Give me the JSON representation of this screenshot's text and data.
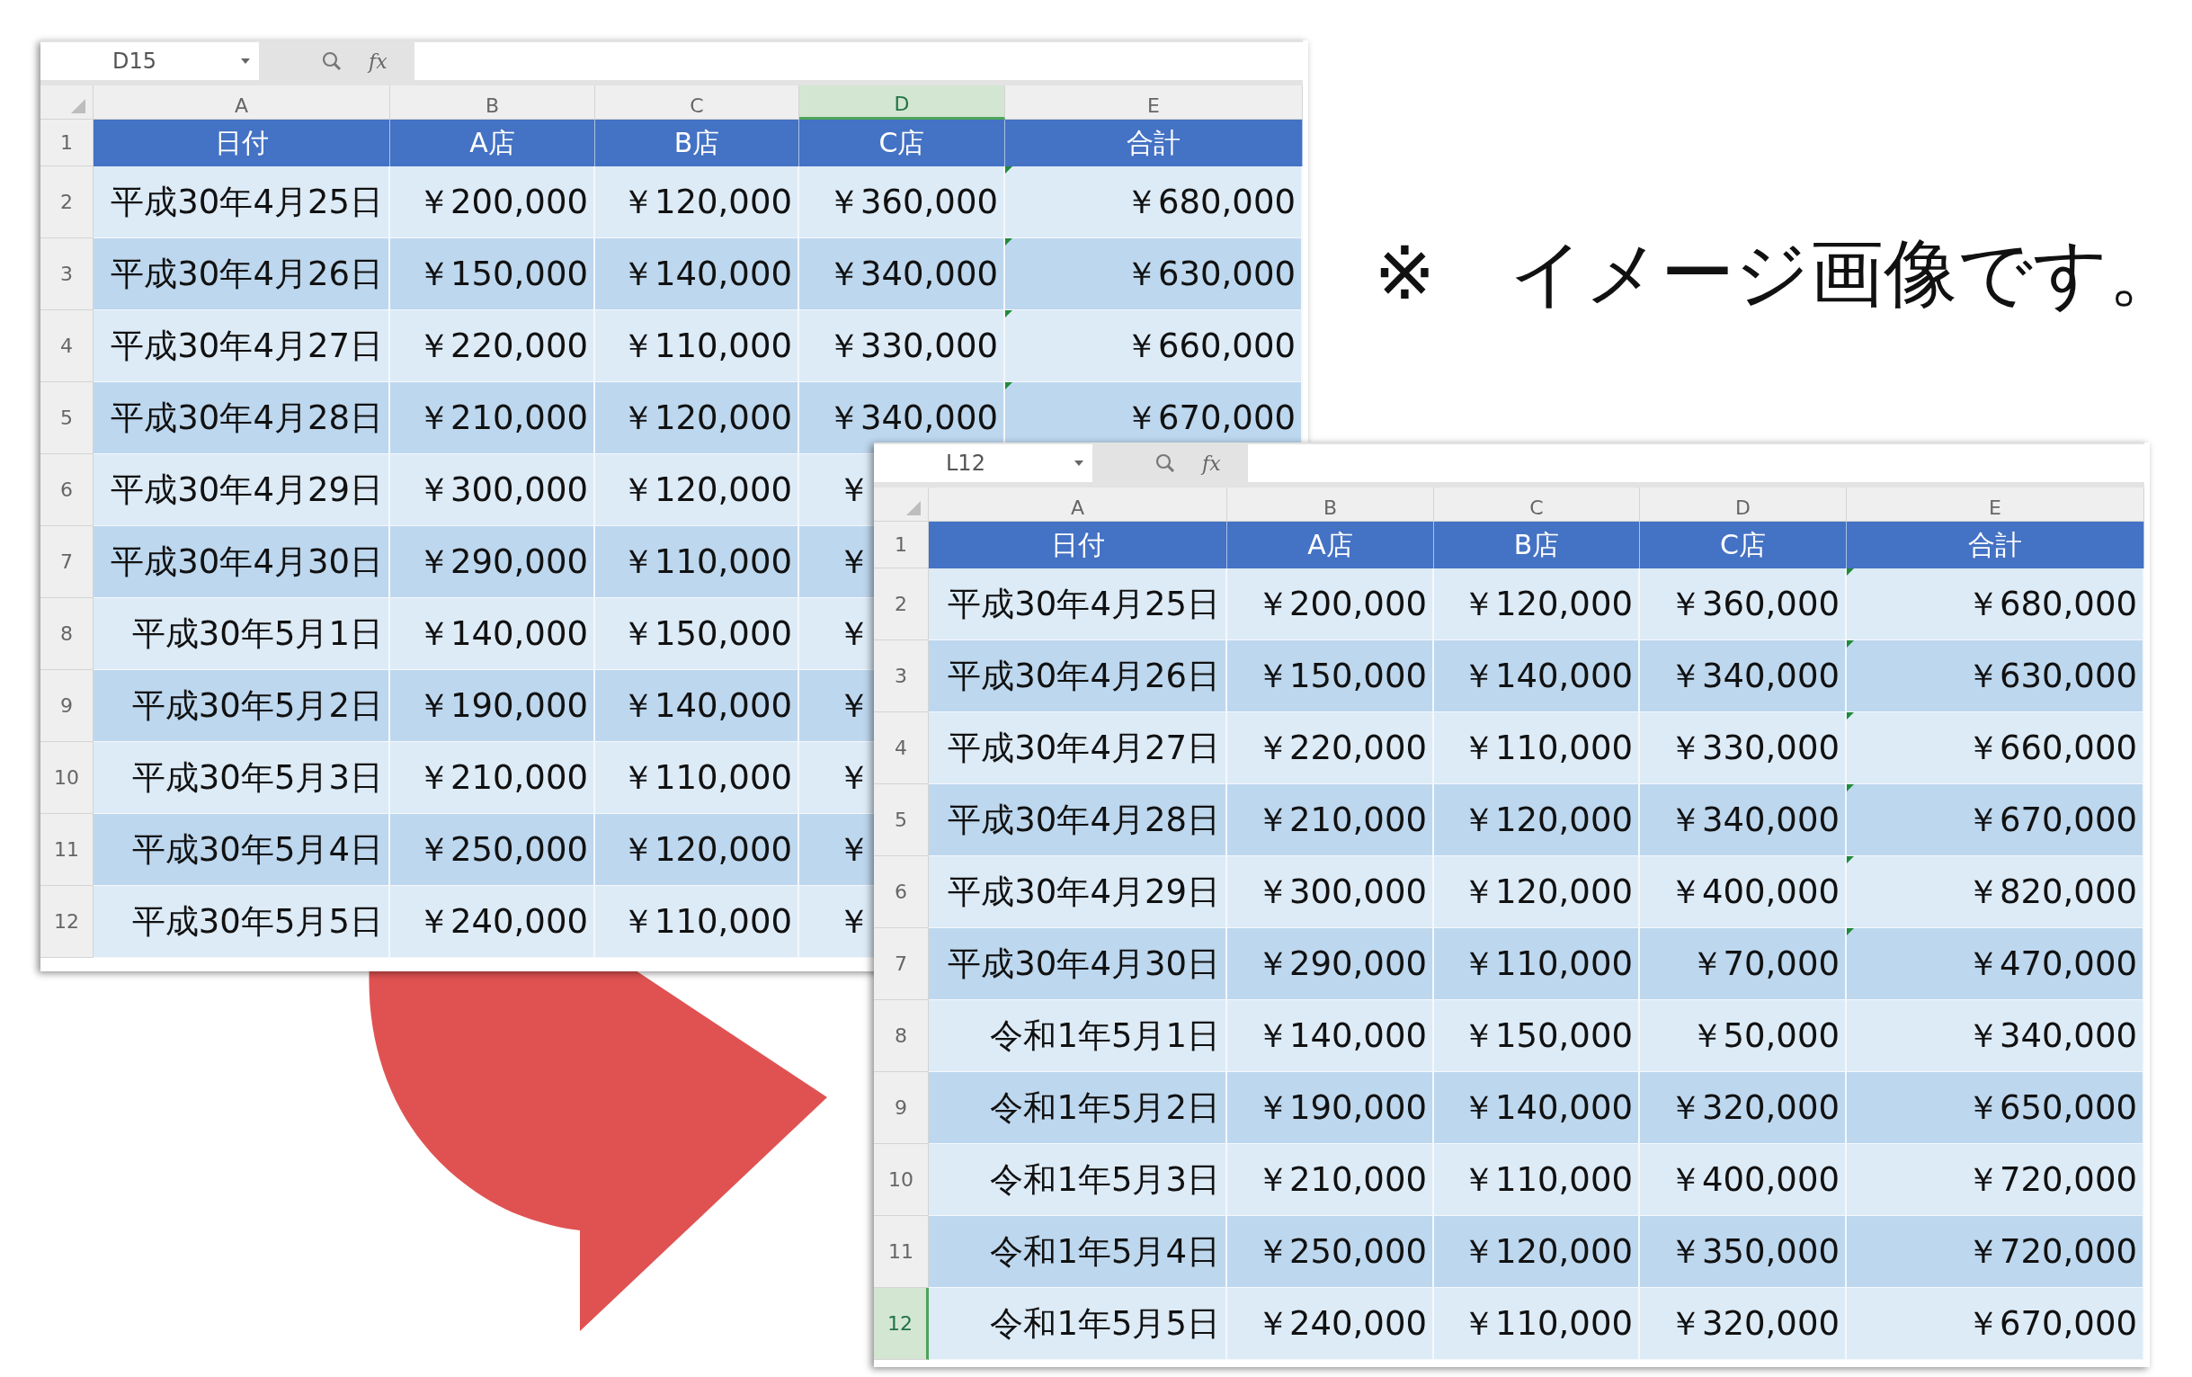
{
  "sheets": [
    {
      "name_box": "D15",
      "formula_label": "fx",
      "columns": [
        {
          "letter": "A",
          "selected": false
        },
        {
          "letter": "B",
          "selected": false
        },
        {
          "letter": "C",
          "selected": false
        },
        {
          "letter": "D",
          "selected": true
        },
        {
          "letter": "E",
          "selected": false
        }
      ],
      "header": {
        "number": "1",
        "selected": false,
        "cells": [
          "日付",
          "A店",
          "B店",
          "C店",
          "合計"
        ]
      },
      "rows": [
        {
          "number": "2",
          "selected": false,
          "error_mark": true,
          "cells": [
            "平成30年4月25日",
            "￥200,000",
            "￥120,000",
            "￥360,000",
            "￥680,000"
          ]
        },
        {
          "number": "3",
          "selected": false,
          "error_mark": true,
          "cells": [
            "平成30年4月26日",
            "￥150,000",
            "￥140,000",
            "￥340,000",
            "￥630,000"
          ]
        },
        {
          "number": "4",
          "selected": false,
          "error_mark": true,
          "cells": [
            "平成30年4月27日",
            "￥220,000",
            "￥110,000",
            "￥330,000",
            "￥660,000"
          ]
        },
        {
          "number": "5",
          "selected": false,
          "error_mark": true,
          "cells": [
            "平成30年4月28日",
            "￥210,000",
            "￥120,000",
            "￥340,000",
            "￥670,000"
          ]
        },
        {
          "number": "6",
          "selected": false,
          "error_mark": false,
          "cells": [
            "平成30年4月29日",
            "￥300,000",
            "￥120,000",
            "￥"
          ]
        },
        {
          "number": "7",
          "selected": false,
          "error_mark": false,
          "cells": [
            "平成30年4月30日",
            "￥290,000",
            "￥110,000",
            "￥"
          ]
        },
        {
          "number": "8",
          "selected": false,
          "error_mark": false,
          "cells": [
            "平成30年5月1日",
            "￥140,000",
            "￥150,000",
            "￥"
          ]
        },
        {
          "number": "9",
          "selected": false,
          "error_mark": false,
          "cells": [
            "平成30年5月2日",
            "￥190,000",
            "￥140,000",
            "￥"
          ]
        },
        {
          "number": "10",
          "selected": false,
          "error_mark": false,
          "cells": [
            "平成30年5月3日",
            "￥210,000",
            "￥110,000",
            "￥"
          ]
        },
        {
          "number": "11",
          "selected": false,
          "error_mark": false,
          "cells": [
            "平成30年5月4日",
            "￥250,000",
            "￥120,000",
            "￥"
          ]
        },
        {
          "number": "12",
          "selected": false,
          "error_mark": false,
          "cells": [
            "平成30年5月5日",
            "￥240,000",
            "￥110,000",
            "￥"
          ]
        }
      ]
    },
    {
      "name_box": "L12",
      "formula_label": "fx",
      "columns": [
        {
          "letter": "A",
          "selected": false
        },
        {
          "letter": "B",
          "selected": false
        },
        {
          "letter": "C",
          "selected": false
        },
        {
          "letter": "D",
          "selected": false
        },
        {
          "letter": "E",
          "selected": false
        }
      ],
      "header": {
        "number": "1",
        "selected": false,
        "cells": [
          "日付",
          "A店",
          "B店",
          "C店",
          "合計"
        ]
      },
      "rows": [
        {
          "number": "2",
          "selected": false,
          "error_mark": true,
          "cells": [
            "平成30年4月25日",
            "￥200,000",
            "￥120,000",
            "￥360,000",
            "￥680,000"
          ]
        },
        {
          "number": "3",
          "selected": false,
          "error_mark": true,
          "cells": [
            "平成30年4月26日",
            "￥150,000",
            "￥140,000",
            "￥340,000",
            "￥630,000"
          ]
        },
        {
          "number": "4",
          "selected": false,
          "error_mark": true,
          "cells": [
            "平成30年4月27日",
            "￥220,000",
            "￥110,000",
            "￥330,000",
            "￥660,000"
          ]
        },
        {
          "number": "5",
          "selected": false,
          "error_mark": true,
          "cells": [
            "平成30年4月28日",
            "￥210,000",
            "￥120,000",
            "￥340,000",
            "￥670,000"
          ]
        },
        {
          "number": "6",
          "selected": false,
          "error_mark": true,
          "cells": [
            "平成30年4月29日",
            "￥300,000",
            "￥120,000",
            "￥400,000",
            "￥820,000"
          ]
        },
        {
          "number": "7",
          "selected": false,
          "error_mark": true,
          "cells": [
            "平成30年4月30日",
            "￥290,000",
            "￥110,000",
            "￥70,000",
            "￥470,000"
          ]
        },
        {
          "number": "8",
          "selected": false,
          "error_mark": false,
          "cells": [
            "令和1年5月1日",
            "￥140,000",
            "￥150,000",
            "￥50,000",
            "￥340,000"
          ]
        },
        {
          "number": "9",
          "selected": false,
          "error_mark": false,
          "cells": [
            "令和1年5月2日",
            "￥190,000",
            "￥140,000",
            "￥320,000",
            "￥650,000"
          ]
        },
        {
          "number": "10",
          "selected": false,
          "error_mark": false,
          "cells": [
            "令和1年5月3日",
            "￥210,000",
            "￥110,000",
            "￥400,000",
            "￥720,000"
          ]
        },
        {
          "number": "11",
          "selected": false,
          "error_mark": false,
          "cells": [
            "令和1年5月4日",
            "￥250,000",
            "￥120,000",
            "￥350,000",
            "￥720,000"
          ]
        },
        {
          "number": "12",
          "selected": true,
          "error_mark": false,
          "cells": [
            "令和1年5月5日",
            "￥240,000",
            "￥110,000",
            "￥320,000",
            "￥670,000"
          ]
        }
      ]
    }
  ],
  "note": "※　イメージ画像です。"
}
